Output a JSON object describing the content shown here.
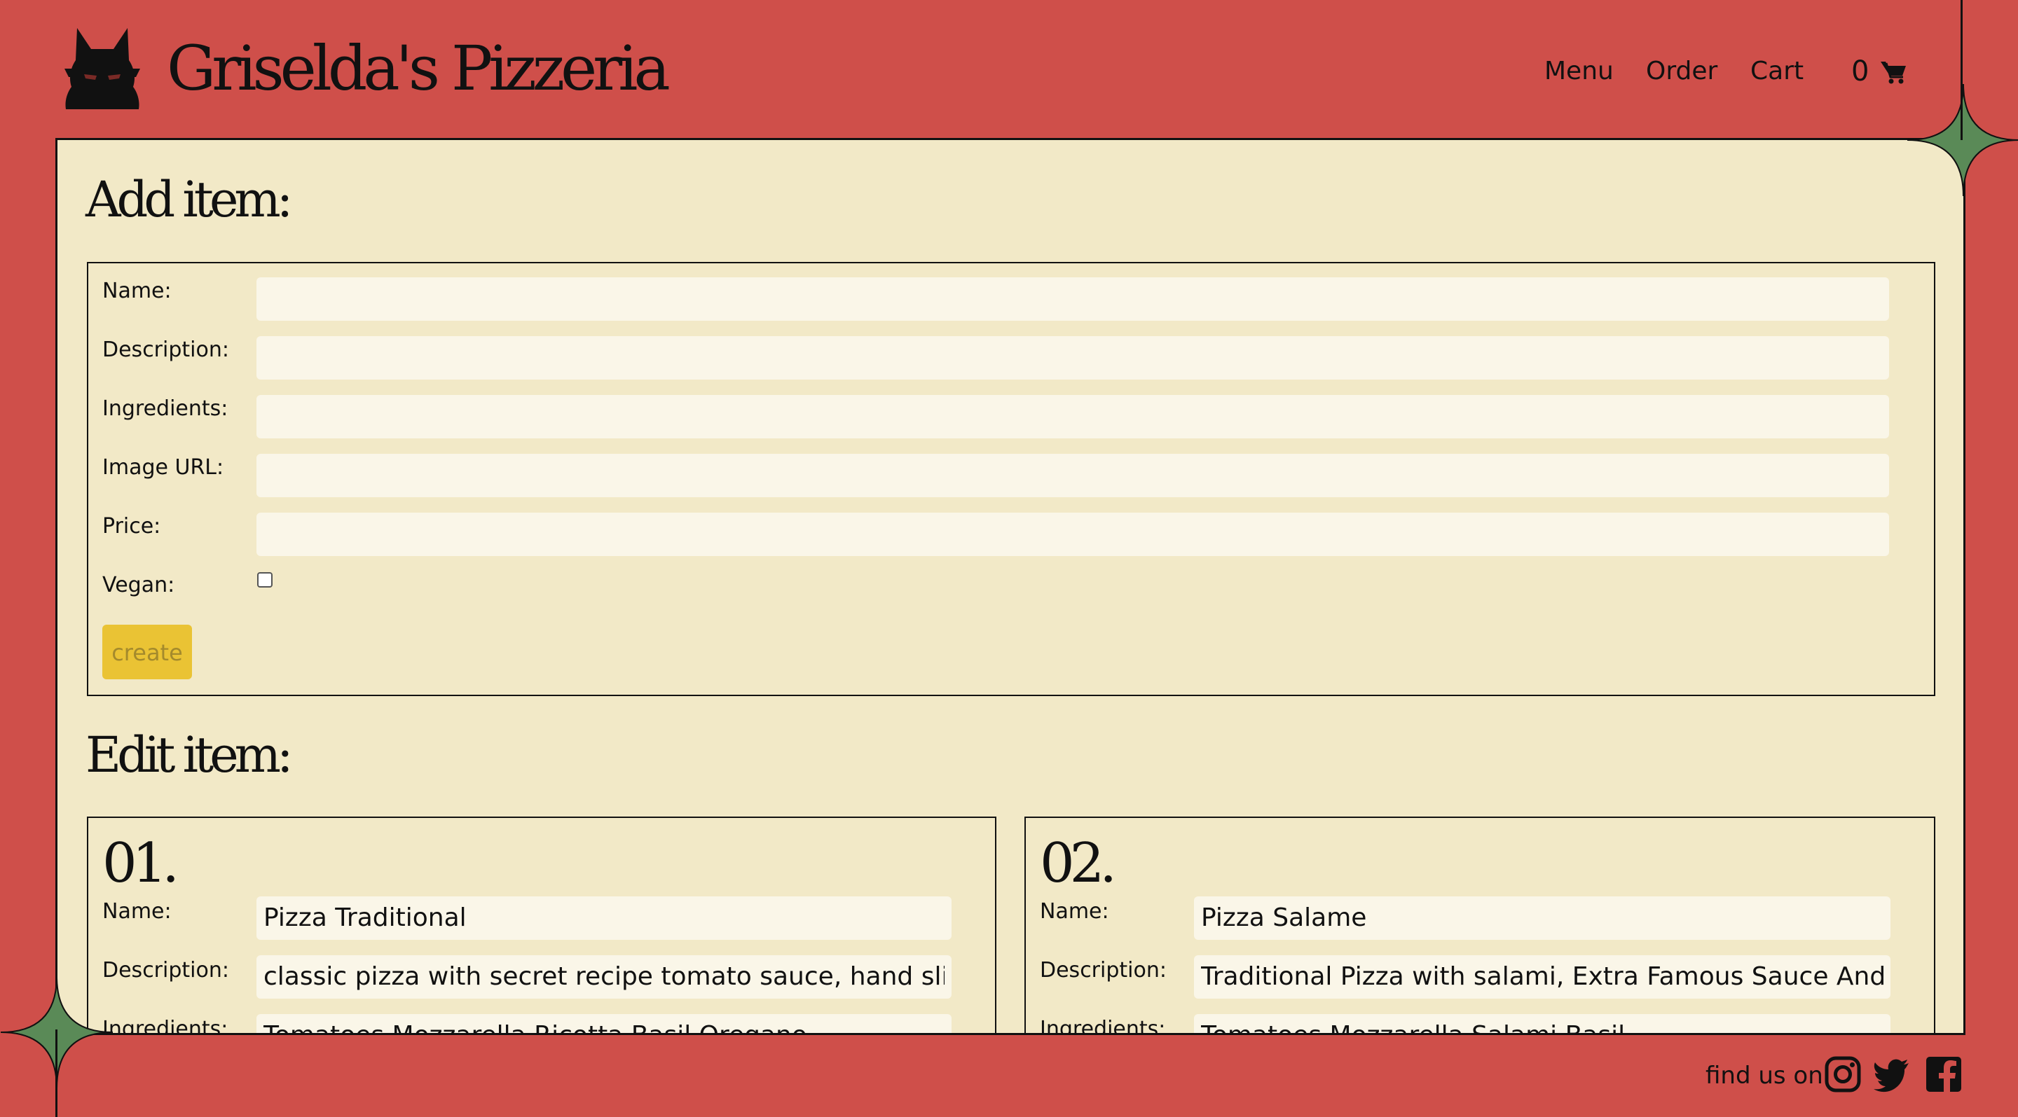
{
  "header": {
    "brand": "Griselda's Pizzeria",
    "nav": {
      "menu": "Menu",
      "order": "Order",
      "cart": "Cart"
    },
    "cart_count": "0"
  },
  "add_item": {
    "title": "Add item:",
    "fields": {
      "name_label": "Name:",
      "description_label": "Description:",
      "ingredients_label": "Ingredients:",
      "image_url_label": "Image URL:",
      "price_label": "Price:",
      "vegan_label": "Vegan:"
    },
    "values": {
      "name": "",
      "description": "",
      "ingredients": "",
      "image_url": "",
      "price": ""
    },
    "vegan_checked": false,
    "create_label": "create"
  },
  "edit_item": {
    "title": "Edit item:",
    "items": [
      {
        "number": "01.",
        "name_label": "Name:",
        "description_label": "Description:",
        "ingredients_label": "Ingredients:",
        "name": "Pizza Traditional",
        "description": "classic pizza with secret recipe tomato sauce, hand sliced moz",
        "ingredients": "Tomatoes Mozzarella Ricotta Basil Oregano"
      },
      {
        "number": "02.",
        "name_label": "Name:",
        "description_label": "Description:",
        "ingredients_label": "Ingredients:",
        "name": "Pizza Salame",
        "description": "Traditional Pizza with salami, Extra Famous Sauce And Fresh I",
        "ingredients": "Tomatoes Mozzarella Salami Basil"
      }
    ]
  },
  "footer": {
    "find_us": "find us on:",
    "icons": [
      "instagram-icon",
      "twitter-icon",
      "facebook-icon"
    ]
  },
  "colors": {
    "background": "#cf4f4a",
    "panel": "#f2e9c7",
    "input": "#faf6e8",
    "button": "#eac334",
    "star": "#5a8a57"
  }
}
